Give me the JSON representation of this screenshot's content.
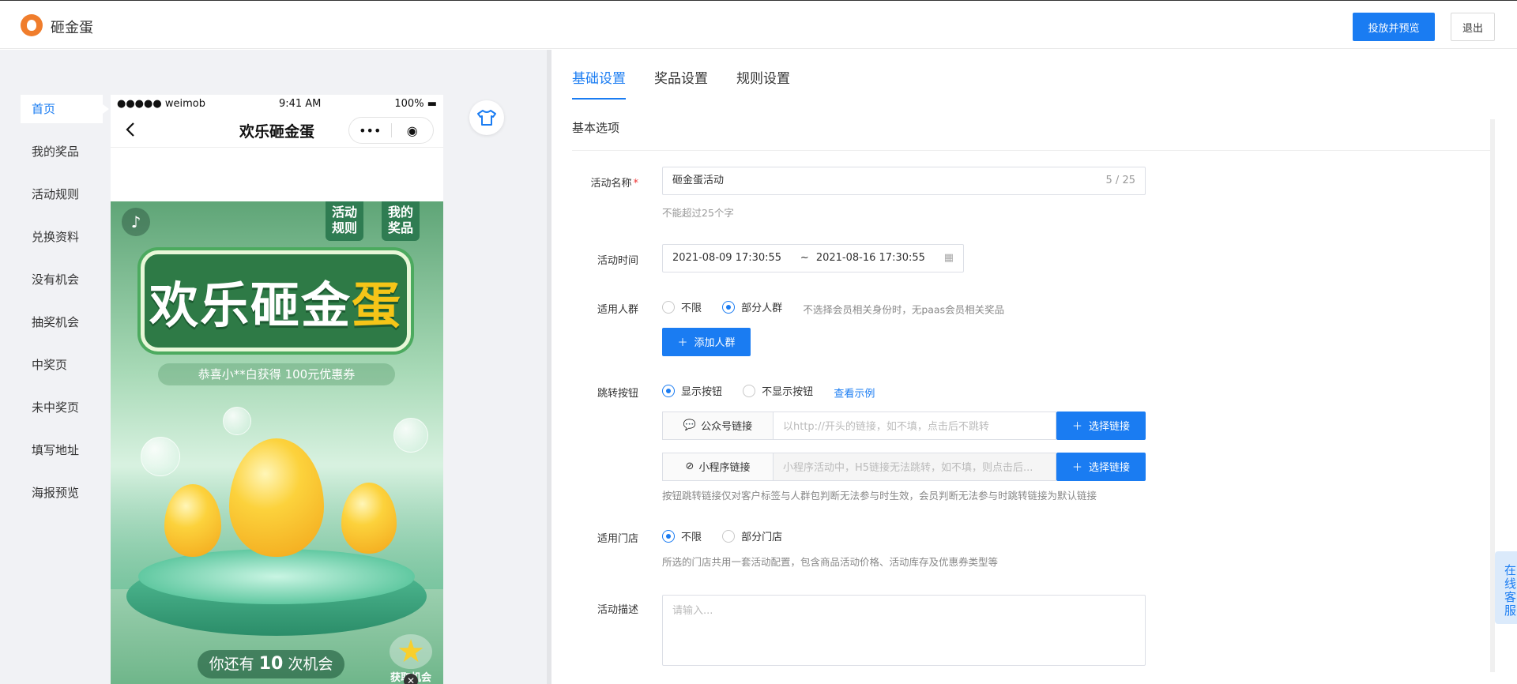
{
  "app": {
    "title": "砸金蛋"
  },
  "header": {
    "preview_button": "投放并预览",
    "logout_button": "退出"
  },
  "page_nav": {
    "items": [
      {
        "label": "首页",
        "active": true
      },
      {
        "label": "我的奖品"
      },
      {
        "label": "活动规则"
      },
      {
        "label": "兑换资料"
      },
      {
        "label": "没有机会"
      },
      {
        "label": "抽奖机会"
      },
      {
        "label": "中奖页"
      },
      {
        "label": "未中奖页"
      },
      {
        "label": "填写地址"
      },
      {
        "label": "海报预览"
      }
    ]
  },
  "phone": {
    "carrier": "●●●●● weimob",
    "time": "9:41 AM",
    "battery": "100%",
    "title": "欢乐砸金蛋",
    "capsule_more": "•••",
    "game": {
      "tag_rules": "活动\n规则",
      "tag_prizes": "我的\n奖品",
      "banner_main": "欢乐砸金",
      "banner_accent": "蛋",
      "winner_notice": "恭喜小**白获得 100元优惠券",
      "chances_prefix": "你还有",
      "chances_count": "10",
      "chances_suffix": "次机会",
      "get_more": "获取机会"
    }
  },
  "settings": {
    "tabs": [
      {
        "label": "基础设置",
        "active": true
      },
      {
        "label": "奖品设置"
      },
      {
        "label": "规则设置"
      }
    ],
    "section_title": "基本选项",
    "activity_name": {
      "label": "活动名称",
      "value": "砸金蛋活动",
      "counter": "5 / 25",
      "hint": "不能超过25个字"
    },
    "activity_time": {
      "label": "活动时间",
      "start": "2021-08-09 17:30:55",
      "separator": "~",
      "end": "2021-08-16 17:30:55"
    },
    "audience": {
      "label": "适用人群",
      "options": [
        "不限",
        "部分人群"
      ],
      "selected": "部分人群",
      "note": "不选择会员相关身份时，无paas会员相关奖品",
      "add_button": "添加人群"
    },
    "jump_button": {
      "label": "跳转按钮",
      "options": [
        "显示按钮",
        "不显示按钮"
      ],
      "selected": "显示按钮",
      "example_link": "查看示例",
      "official_account": {
        "type": "公众号链接",
        "placeholder": "以http://开头的链接，如不填，点击后不跳转",
        "button": "选择链接"
      },
      "mini_program": {
        "type": "小程序链接",
        "placeholder": "小程序活动中，H5链接无法跳转，如不填，则点击后...",
        "button": "选择链接"
      },
      "hint": "按钮跳转链接仅对客户标签与人群包判断无法参与时生效，会员判断无法参与时跳转链接为默认链接"
    },
    "stores": {
      "label": "适用门店",
      "options": [
        "不限",
        "部分门店"
      ],
      "selected": "不限",
      "hint": "所选的门店共用一套活动配置，包含商品活动价格、活动库存及优惠券类型等"
    },
    "description": {
      "label": "活动描述",
      "placeholder": "请输入..."
    }
  },
  "service": {
    "label": "在线客服"
  },
  "colors": {
    "primary": "#1a7cf2",
    "brand": "#f07d2c",
    "game_green": "#2f7c52"
  }
}
